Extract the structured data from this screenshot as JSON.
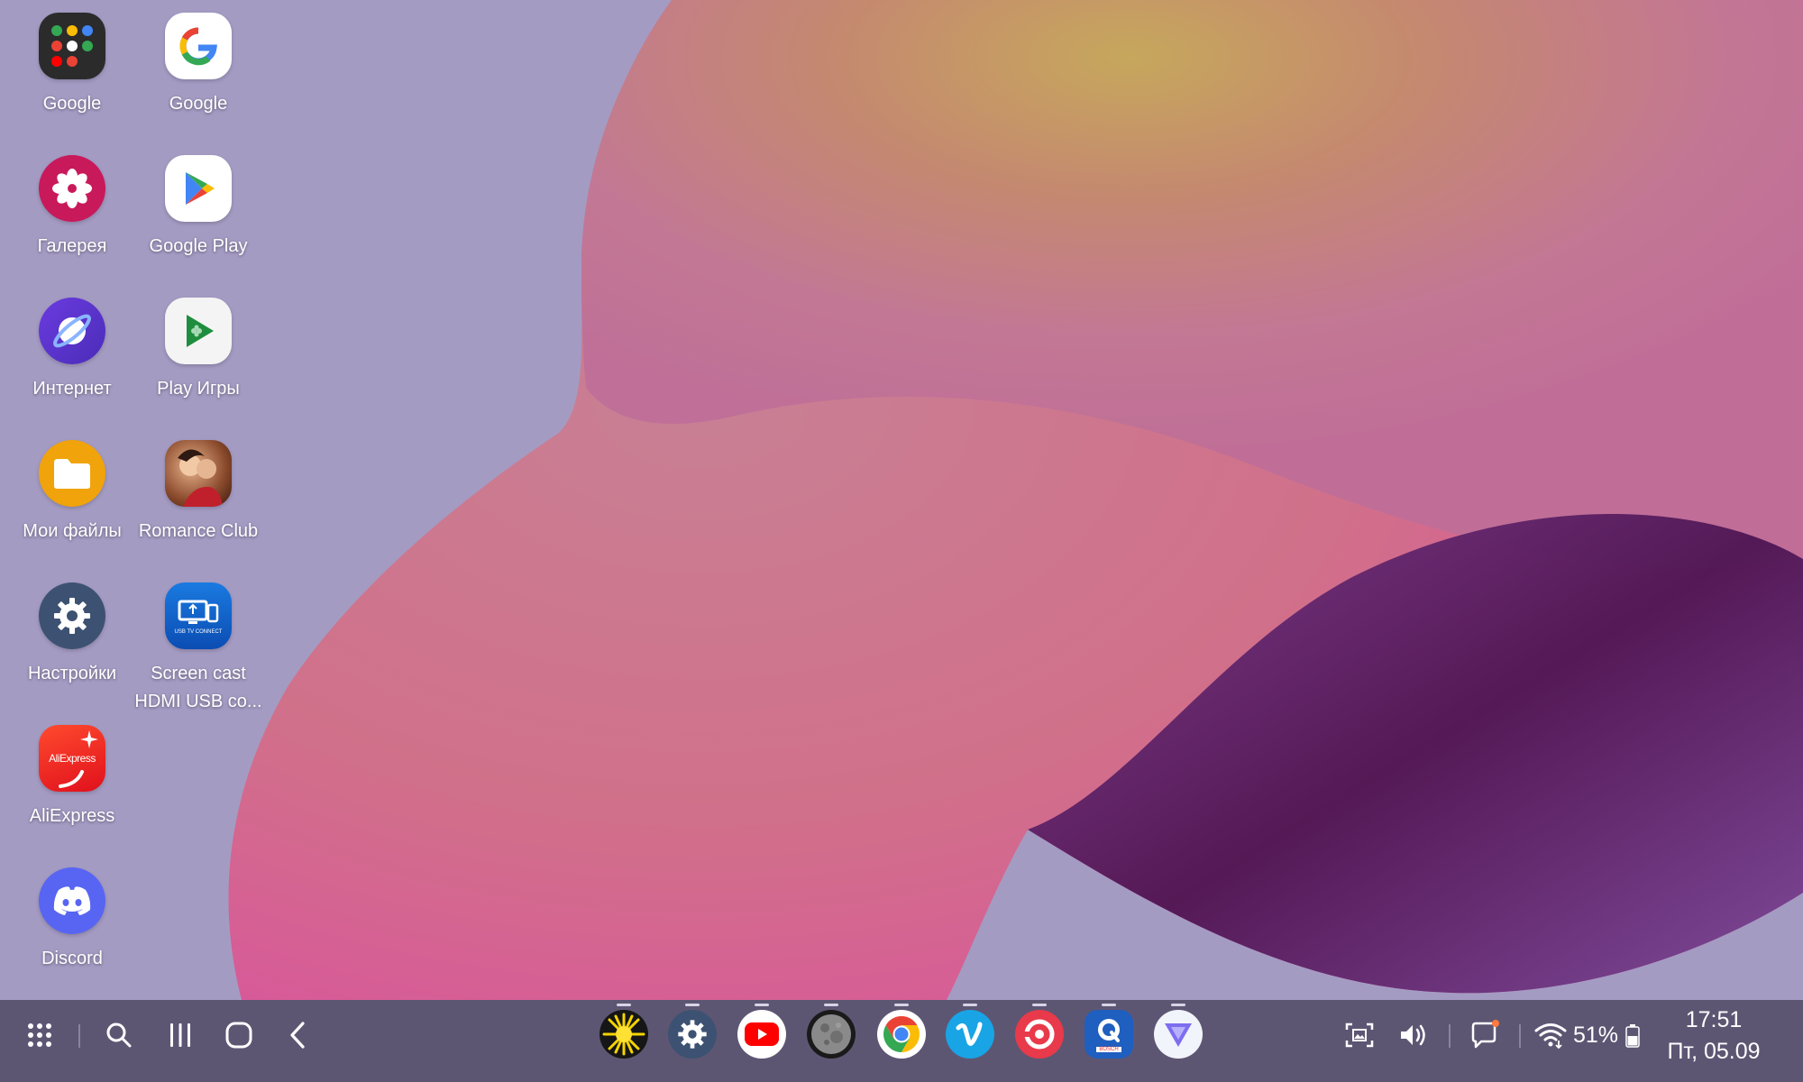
{
  "apps": [
    {
      "name": "google-folder",
      "label": "Google"
    },
    {
      "name": "google-app",
      "label": "Google"
    },
    {
      "name": "gallery-app",
      "label": "Галерея"
    },
    {
      "name": "google-play-app",
      "label": "Google Play"
    },
    {
      "name": "internet-app",
      "label": "Интернет"
    },
    {
      "name": "play-games-app",
      "label": "Play Игры"
    },
    {
      "name": "my-files-app",
      "label": "Мои файлы"
    },
    {
      "name": "romance-club-app",
      "label": "Romance Club"
    },
    {
      "name": "settings-app",
      "label": "Настройки"
    },
    {
      "name": "screen-cast-app",
      "label": "Screen cast HDMI USB co..."
    },
    {
      "name": "aliexpress-app",
      "label": "AliExpress"
    },
    {
      "name": "discord-app",
      "label": "Discord"
    }
  ],
  "icon_text": {
    "aliexpress": "AliExpress",
    "screencast": "USB TV CONNECT",
    "bosch": "BOSCH"
  },
  "taskbar": {
    "left_icons": [
      "apps-grid-icon",
      "search-icon",
      "recents-icon",
      "home-icon",
      "back-icon"
    ],
    "dock_icons": [
      "sun-app-icon",
      "settings-dock-icon",
      "youtube-icon",
      "moon-app-icon",
      "chrome-icon",
      "vimeo-icon",
      "record-app-icon",
      "bosch-app-icon",
      "vpn-app-icon"
    ],
    "battery": "51%",
    "time": "17:51",
    "date": "Пт, 05.09"
  },
  "colors": {
    "desktop_bg": "#a49bc3",
    "taskbar_bg": "#5d5673",
    "notification_dot": "#ff7a3d"
  }
}
